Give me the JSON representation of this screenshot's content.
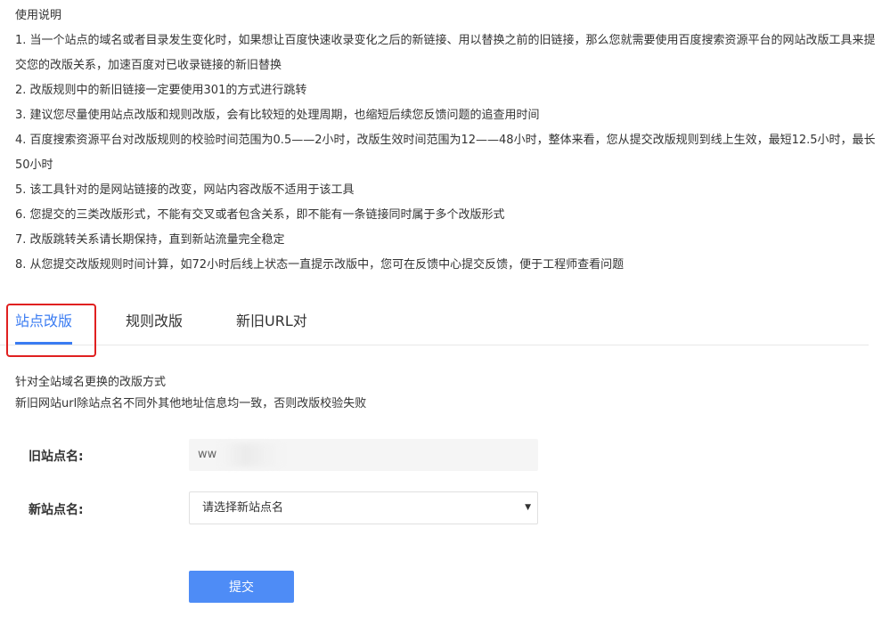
{
  "instructions": {
    "heading": "使用说明",
    "items": [
      "1. 当一个站点的域名或者目录发生变化时，如果想让百度快速收录变化之后的新链接、用以替换之前的旧链接，那么您就需要使用百度搜索资源平台的网站改版工具来提交您的改版关系，加速百度对已收录链接的新旧替换",
      "2. 改版规则中的新旧链接一定要使用301的方式进行跳转",
      "3. 建议您尽量使用站点改版和规则改版，会有比较短的处理周期，也缩短后续您反馈问题的追查用时间",
      "4. 百度搜索资源平台对改版规则的校验时间范围为0.5——2小时，改版生效时间范围为12——48小时，整体来看，您从提交改版规则到线上生效，最短12.5小时，最长50小时",
      "5. 该工具针对的是网站链接的改变，网站内容改版不适用于该工具",
      "6. 您提交的三类改版形式，不能有交叉或者包含关系，即不能有一条链接同时属于多个改版形式",
      "7. 改版跳转关系请长期保持，直到新站流量完全稳定",
      "8. 从您提交改版规则时间计算，如72小时后线上状态一直提示改版中，您可在反馈中心提交反馈，便于工程师查看问题"
    ]
  },
  "tabs": [
    {
      "label": "站点改版",
      "active": true
    },
    {
      "label": "规则改版",
      "active": false
    },
    {
      "label": "新旧URL对",
      "active": false
    }
  ],
  "description": {
    "line1": "针对全站域名更换的改版方式",
    "line2": "新旧网站url除站点名不同外其他地址信息均一致，否则改版校验失败"
  },
  "form": {
    "old_site_label": "旧站点名:",
    "old_site_value": "ww",
    "new_site_label": "新站点名:",
    "new_site_placeholder": "请选择新站点名",
    "submit_label": "提交"
  },
  "colors": {
    "accent": "#3b7cf2",
    "button": "#4e8cf6",
    "highlight": "#e02020"
  },
  "icons": {
    "select_arrow": "caret-down-icon"
  }
}
